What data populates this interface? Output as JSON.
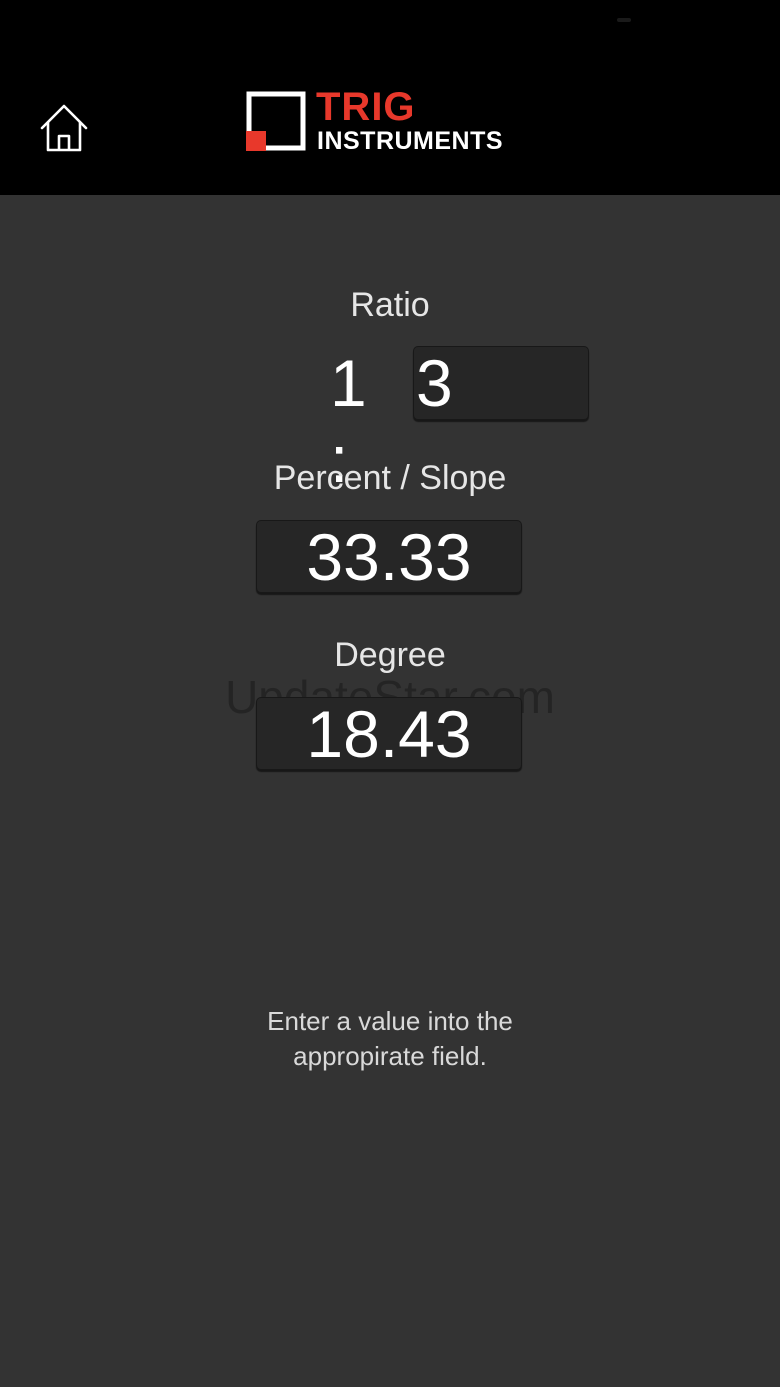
{
  "app": {
    "name": "Trig Instruments",
    "logo_line1": "TRIG",
    "logo_line2": "INSTRUMENTS",
    "brand_color": "#e8382b",
    "header_background": "#000000",
    "page_background": "#333333"
  },
  "header": {
    "home_icon": "home-icon"
  },
  "ratio": {
    "label": "Ratio",
    "prefix": "1 :",
    "value": "3"
  },
  "percent": {
    "label": "Percent / Slope",
    "value": "33.33"
  },
  "degree": {
    "label": "Degree",
    "value": "18.43"
  },
  "watermark": "UpdateStar.com",
  "hint": "Enter a value into the appropirate field."
}
